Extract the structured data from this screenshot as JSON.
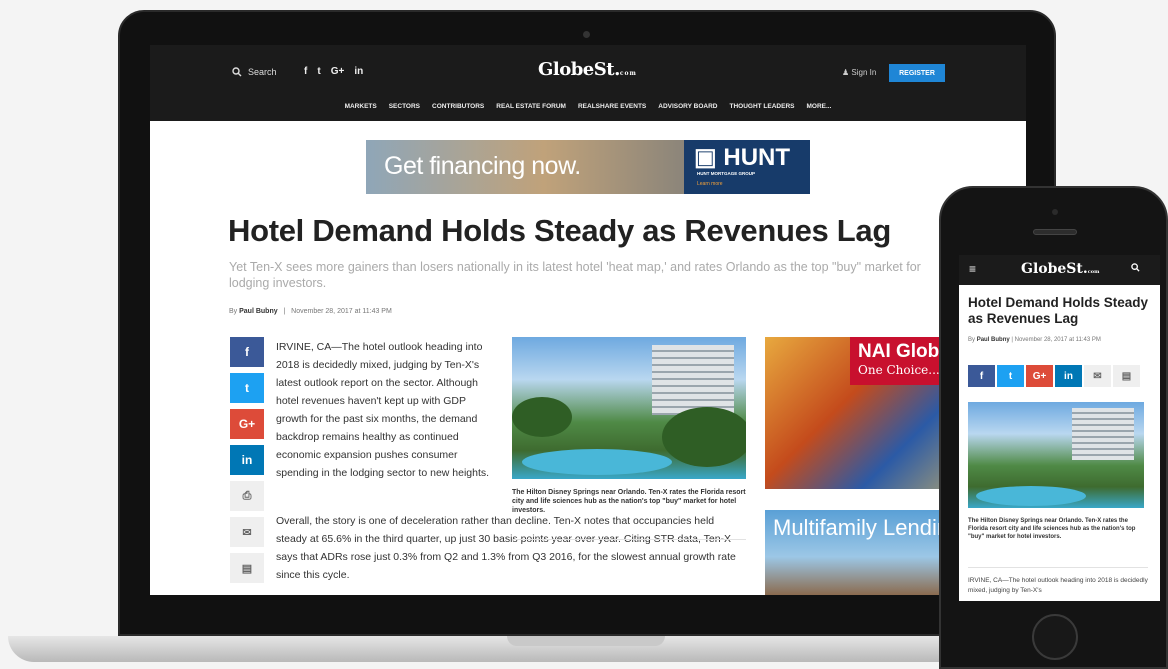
{
  "header": {
    "search_label": "Search",
    "social_icons": [
      "f",
      "t",
      "G+",
      "in"
    ],
    "logo": "GlobeSt.",
    "logo_suffix": "com",
    "signin": "Sign In",
    "register": "REGISTER",
    "nav": [
      "MARKETS",
      "SECTORS",
      "CONTRIBUTORS",
      "REAL ESTATE FORUM",
      "REALSHARE EVENTS",
      "ADVISORY BOARD",
      "THOUGHT LEADERS",
      "MORE..."
    ]
  },
  "ad_top": {
    "headline": "Get financing now.",
    "brand": "HUNT",
    "brand_sub": "HUNT MORTGAGE GROUP",
    "cta": "Learn more"
  },
  "article": {
    "title": "Hotel Demand Holds Steady as Revenues Lag",
    "subtitle": "Yet Ten-X sees more gainers than losers nationally in its latest hotel 'heat map,' and rates Orlando as the top \"buy\" market for lodging investors.",
    "by": "By",
    "author": "Paul Bubny",
    "date": "November 28, 2017 at 11:43 PM",
    "paragraph1": "IRVINE, CA—The hotel outlook heading into 2018 is decidedly mixed, judging by Ten-X's latest outlook report on the sector. Although hotel revenues haven't kept up with GDP growth for the past six months, the demand backdrop remains healthy as continued economic expansion pushes consumer spending in the lodging sector to new heights.",
    "paragraph2": "Overall, the story is one of deceleration rather than decline. Ten-X notes that occupancies held steady at 65.6% in the third quarter, up just 30 basis points year over year. Citing STR data, Ten-X says that ADRs rose just 0.3% from Q2 and 1.3% from Q3 2016, for the slowest annual growth rate since this cycle.",
    "photo_caption": "The Hilton Disney Springs near Orlando. Ten-X rates the Florida resort city and life sciences hub as the nation's top \"buy\" market for hotel investors."
  },
  "share": {
    "facebook": "f",
    "twitter": "t",
    "googleplus": "G+",
    "linkedin": "in",
    "print": "⎙",
    "email": "✉",
    "doc": "▤"
  },
  "ad_side": {
    "brand": "NAI Global",
    "tagline": "One Choice...",
    "multifamily": "Multifamily Lending"
  },
  "phone": {
    "menu": "≡",
    "logo": "GlobeSt.",
    "logo_suffix": "com",
    "title": "Hotel Demand Holds Steady as Revenues Lag",
    "by": "By",
    "author": "Paul Bubny",
    "date": "November 28, 2017 at 11:43 PM",
    "caption": "The Hilton Disney Springs near Orlando. Ten-X rates the Florida resort city and life sciences hub as the nation's top \"buy\" market for hotel investors.",
    "body": "IRVINE, CA—The hotel outlook heading into 2018 is decidedly mixed, judging by Ten-X's"
  },
  "colors": {
    "facebook": "#3b5998",
    "twitter": "#1da1f2",
    "googleplus": "#dd4b39",
    "linkedin": "#0077b5",
    "register": "#1f86d6",
    "header_bg": "#1b1b1b"
  }
}
